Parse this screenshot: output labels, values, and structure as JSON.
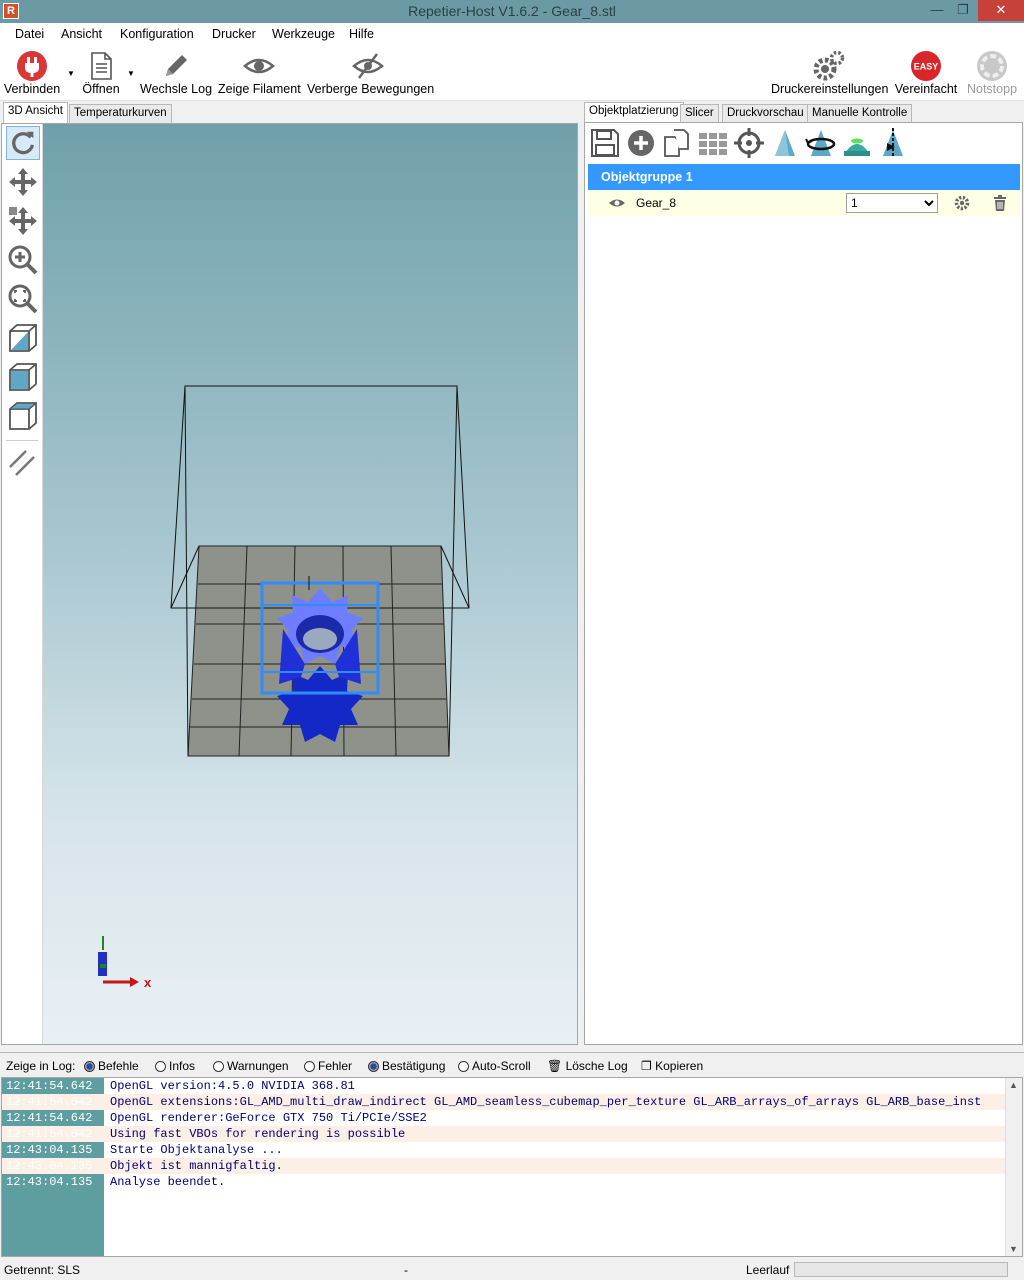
{
  "window": {
    "title": "Repetier-Host V1.6.2 - Gear_8.stl",
    "logo": "R"
  },
  "menu": [
    "Datei",
    "Ansicht",
    "Konfiguration",
    "Drucker",
    "Werkzeuge",
    "Hilfe"
  ],
  "toolbar": {
    "connect": "Verbinden",
    "open": "Öffnen",
    "toggle_log": "Wechsle Log",
    "show_filament": "Zeige Filament",
    "hide_moves": "Verberge Bewegungen",
    "printer_settings": "Druckereinstellungen",
    "simplified": "Vereinfacht",
    "simplified_badge": "EASY",
    "emergency_stop": "Notstopp"
  },
  "left_tabs": [
    "3D Ansicht",
    "Temperaturkurven"
  ],
  "right_tabs": [
    "Objektplatzierung",
    "Slicer",
    "Druckvorschau",
    "Manuelle Kontrolle"
  ],
  "object_panel": {
    "group_name": "Objektgruppe 1",
    "objects": [
      {
        "name": "Gear_8",
        "copies": "1"
      }
    ]
  },
  "log_filter": {
    "label": "Zeige in Log:",
    "options": [
      {
        "label": "Befehle",
        "checked": true
      },
      {
        "label": "Infos",
        "checked": false
      },
      {
        "label": "Warnungen",
        "checked": false
      },
      {
        "label": "Fehler",
        "checked": false
      },
      {
        "label": "Bestätigung",
        "checked": true
      },
      {
        "label": "Auto-Scroll",
        "checked": false
      }
    ],
    "clear": "Lösche Log",
    "copy": "Kopieren"
  },
  "log": [
    {
      "time": "12:41:54.642",
      "msg": "OpenGL version:4.5.0 NVIDIA 368.81"
    },
    {
      "time": "12:41:54.642",
      "msg": "OpenGL extensions:GL_AMD_multi_draw_indirect GL_AMD_seamless_cubemap_per_texture GL_ARB_arrays_of_arrays GL_ARB_base_inst"
    },
    {
      "time": "12:41:54.642",
      "msg": "OpenGL renderer:GeForce GTX 750 Ti/PCIe/SSE2"
    },
    {
      "time": "12:41:54.642",
      "msg": "Using fast VBOs for rendering is possible"
    },
    {
      "time": "12:43:04.135",
      "msg": "Starte Objektanalyse ..."
    },
    {
      "time": "12:43:04.135",
      "msg": "Objekt ist mannigfaltig."
    },
    {
      "time": "12:43:04.135",
      "msg": "Analyse beendet."
    }
  ],
  "status": {
    "connection": "Getrennt: SLS",
    "middle": "-",
    "state": "Leerlauf"
  },
  "axis": {
    "x_label": "x"
  },
  "colors": {
    "connect": "#d93636",
    "easy": "#d9262b",
    "selection": "#3399ff",
    "gear": "#3a4cff"
  }
}
